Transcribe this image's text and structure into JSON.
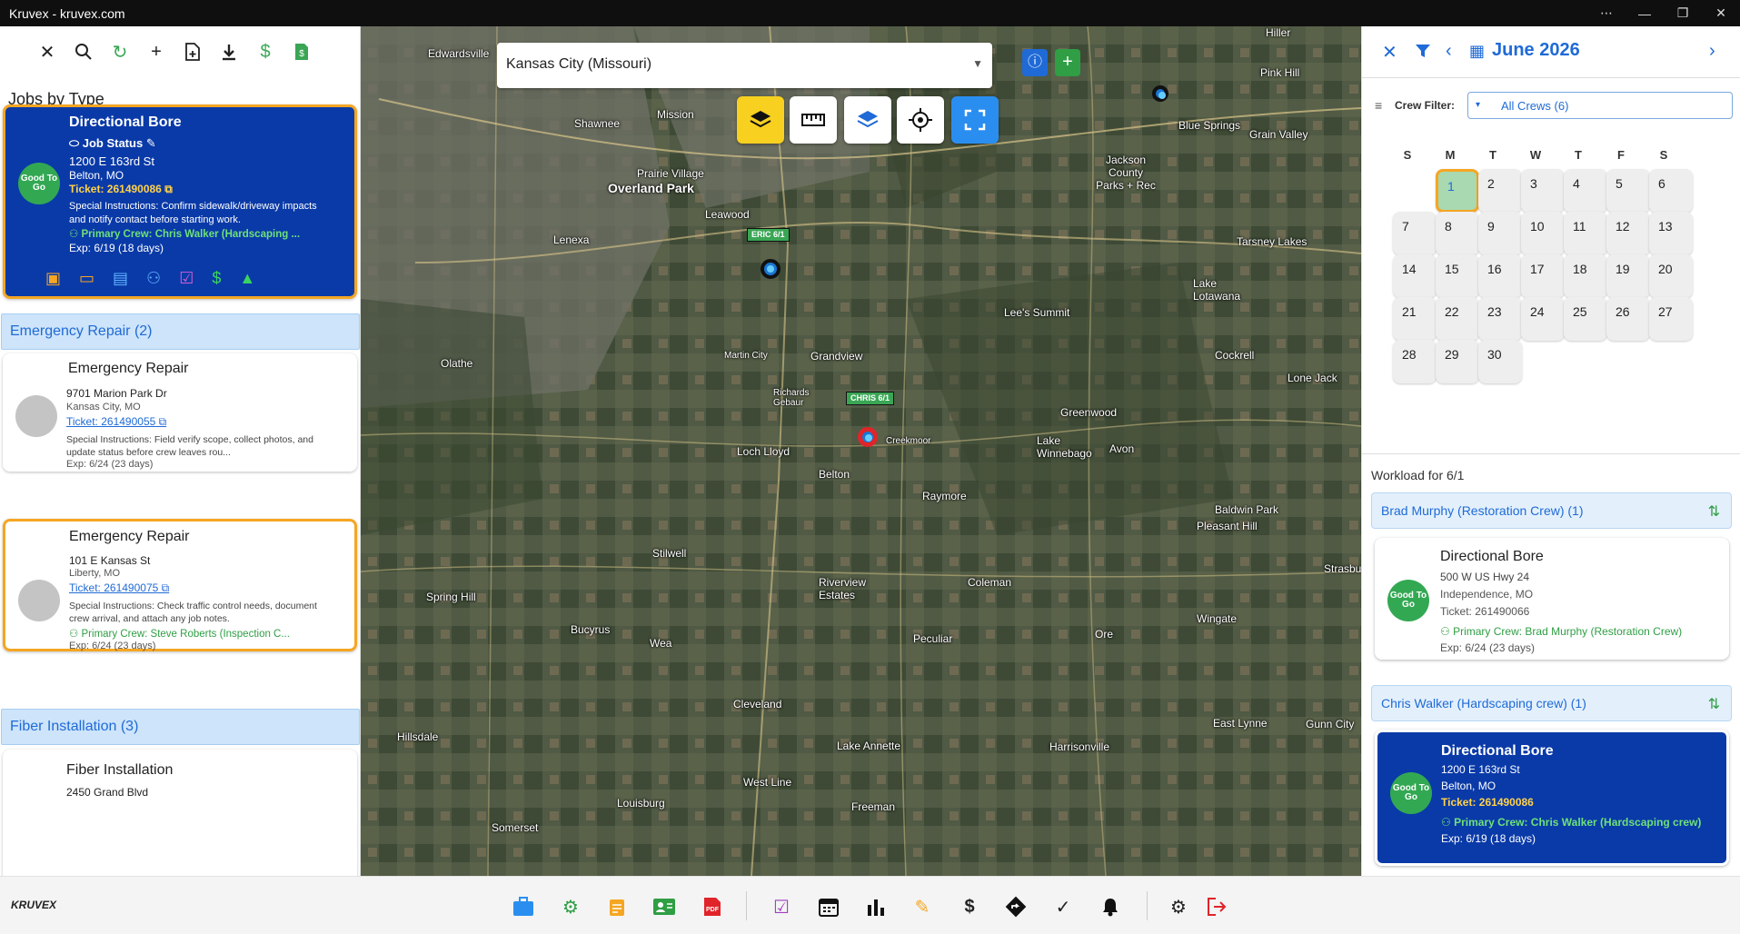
{
  "window": {
    "title": "Kruvex - kruvex.com",
    "controls": [
      "⋯",
      "—",
      "❐",
      "✕"
    ]
  },
  "left": {
    "heading": "Jobs by Type",
    "selected_card": {
      "title": "Directional Bore",
      "status": "Job Status",
      "address": "1200 E 163rd St",
      "city": "Belton, MO",
      "ticket": "Ticket: 261490086",
      "badge": "Good To Go",
      "instructions": "Special Instructions: Confirm sidewalk/driveway impacts and notify contact before starting work.",
      "crew": "Primary Crew: Chris Walker (Hardscaping ...",
      "exp": "Exp: 6/19 (18 days)"
    },
    "group1": "Emergency Repair (2)",
    "card1": {
      "title": "Emergency Repair",
      "address": "9701 Marion Park Dr",
      "city": "Kansas City, MO",
      "ticket": "Ticket: 261490055",
      "instructions": "Special Instructions: Field verify scope, collect photos, and update status before crew leaves rou...",
      "exp": "Exp: 6/24 (23 days)"
    },
    "card2": {
      "title": "Emergency Repair",
      "address": "101 E Kansas St",
      "city": "Liberty, MO",
      "ticket": "Ticket: 261490075",
      "instructions": "Special Instructions: Check traffic control needs, document crew arrival, and attach any job notes.",
      "crew": "Primary Crew: Steve Roberts (Inspection C...",
      "exp": "Exp: 6/24 (23 days)"
    },
    "group2": "Fiber Installation (3)",
    "card3": {
      "title": "Fiber Installation",
      "address": "2450 Grand Blvd"
    }
  },
  "map": {
    "location": "Kansas City (Missouri)",
    "places": [
      "Overland Park",
      "Prairie Village",
      "Mission",
      "Shawnee",
      "Lenexa",
      "Leawood",
      "Olathe",
      "Lee's Summit",
      "Belton",
      "Raymore",
      "Grandview",
      "Blue Springs",
      "Grain Valley",
      "Jackson County Parks + Rec",
      "Tarsney Lakes",
      "Lake Lotawana",
      "Greenwood",
      "Lone Jack",
      "Cockrell",
      "Lake Winnebago",
      "Baldwin Park",
      "Pleasant Hill",
      "Strasburg",
      "Coleman",
      "Peculiar",
      "Wingate",
      "Ore",
      "Cleveland",
      "Bucyrus",
      "Wea",
      "Stilwell",
      "Spring Hill",
      "Hillsdale",
      "Louisburg",
      "West Line",
      "Freeman",
      "Lake Annette",
      "Harrisonville",
      "East Lynne",
      "Gunn City",
      "Somerset",
      "Riverview Estates",
      "Loch Lloyd",
      "Martin City",
      "Richards Gebaur",
      "Creekmoor",
      "Avon",
      "Edwardsville",
      "Pink Hill",
      "Hiller"
    ],
    "pins": [
      {
        "label": "ERIC 6/1"
      },
      {
        "label": "CHRIS 6/1"
      }
    ]
  },
  "calendar": {
    "month": "June 2026",
    "crew_filter_label": "Crew Filter:",
    "crew_filter_value": "All Crews (6)",
    "weekdays": [
      "S",
      "M",
      "T",
      "W",
      "T",
      "F",
      "S"
    ],
    "workload_title": "Workload for 6/1",
    "group1": "Brad Murphy (Restoration Crew) (1)",
    "rcard1": {
      "title": "Directional Bore",
      "address": "500 W US Hwy 24",
      "city": "Independence, MO",
      "ticket": "Ticket: 261490066",
      "crew": "Primary Crew: Brad Murphy (Restoration Crew)",
      "exp": "Exp: 6/24 (23 days)",
      "badge": "Good To Go"
    },
    "group2": "Chris Walker (Hardscaping crew) (1)",
    "rcard2": {
      "title": "Directional Bore",
      "address": "1200 E 163rd St",
      "city": "Belton, MO",
      "ticket": "Ticket: 261490086",
      "crew": "Primary Crew: Chris Walker (Hardscaping crew)",
      "exp": "Exp: 6/19 (18 days)",
      "badge": "Good To Go"
    }
  },
  "bottom": {
    "logo": "KRUVEX"
  }
}
